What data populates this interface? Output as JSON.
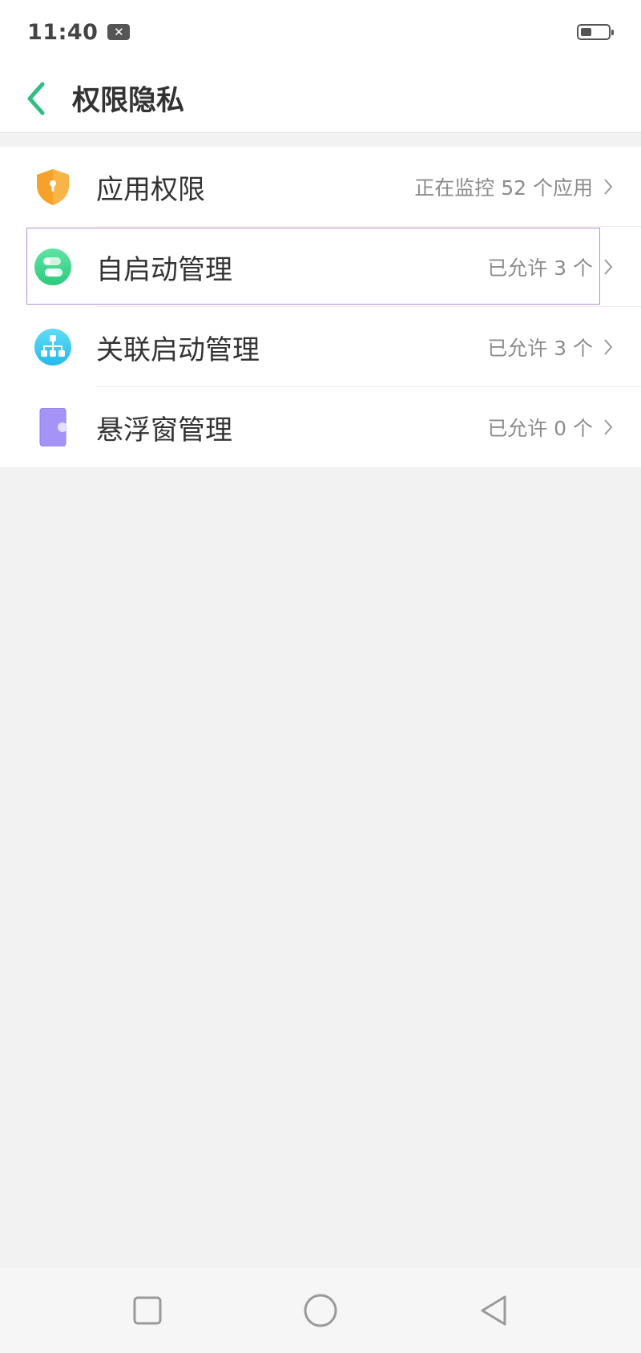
{
  "status_bar": {
    "time": "11:40",
    "notification_glyph": "✕"
  },
  "header": {
    "title": "权限隐私"
  },
  "colors": {
    "accent_green": "#2fbe7f",
    "shield_orange": "#f6a22a",
    "autostart_green": "#3ed48a",
    "link_cyan": "#36c8f0",
    "float_purple": "#9c8cf2"
  },
  "items": [
    {
      "icon": "shield-lock-icon",
      "label": "应用权限",
      "value": "正在监控 52 个应用"
    },
    {
      "icon": "toggle-switch-icon",
      "label": "自启动管理",
      "value": "已允许 3 个"
    },
    {
      "icon": "network-tree-icon",
      "label": "关联启动管理",
      "value": "已允许 3 个"
    },
    {
      "icon": "floating-window-icon",
      "label": "悬浮窗管理",
      "value": "已允许 0 个"
    }
  ]
}
